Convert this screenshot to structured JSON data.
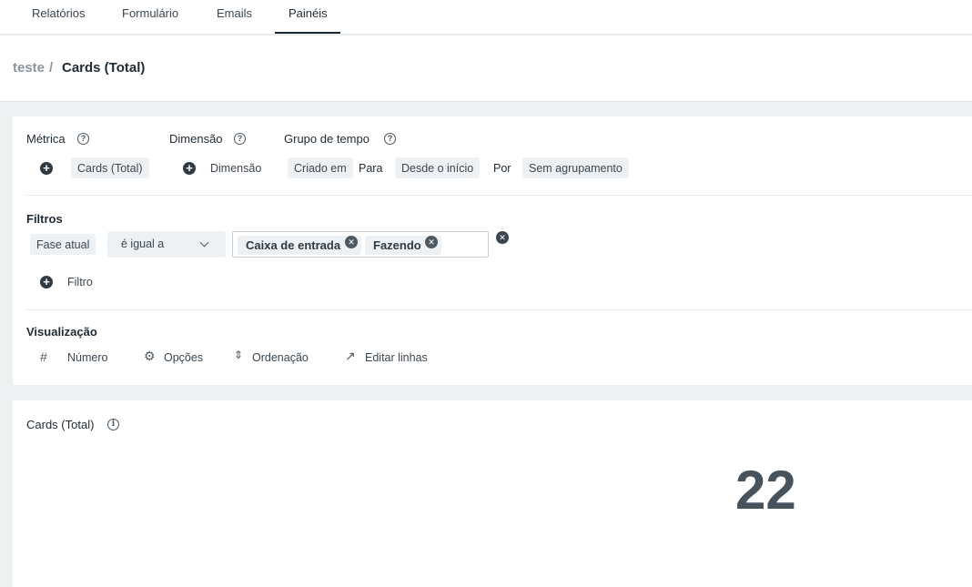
{
  "tabs": [
    {
      "label": "Relatórios"
    },
    {
      "label": "Formulário"
    },
    {
      "label": "Emails"
    },
    {
      "label": "Painéis"
    }
  ],
  "breadcrumb": {
    "parent": "teste",
    "separator": "/",
    "current": "Cards (Total)"
  },
  "metric": {
    "label": "Métrica",
    "value": "Cards (Total)"
  },
  "dimension": {
    "label": "Dimensão",
    "placeholder": "Dimensão"
  },
  "time_group": {
    "label": "Grupo de tempo",
    "field": "Criado em",
    "para_label": "Para",
    "range": "Desde o início",
    "por_label": "Por",
    "grouping": "Sem agrupamento"
  },
  "filters": {
    "label": "Filtros",
    "field": "Fase atual",
    "operator": "é igual a",
    "values": [
      "Caixa de entrada",
      "Fazendo"
    ],
    "add_label": "Filtro"
  },
  "visualization": {
    "label": "Visualização",
    "items": [
      {
        "label": "Número",
        "icon": "hash-icon"
      },
      {
        "label": "Opções",
        "icon": "gear-icon"
      },
      {
        "label": "Ordenação",
        "icon": "sort-icon"
      },
      {
        "label": "Editar linhas",
        "icon": "trend-icon"
      }
    ]
  },
  "result": {
    "title": "Cards (Total)",
    "value": "22"
  },
  "colors": {
    "accent": "#1f2a33",
    "chip_bg": "#eef1f3",
    "page_bg": "#eef1f2"
  }
}
